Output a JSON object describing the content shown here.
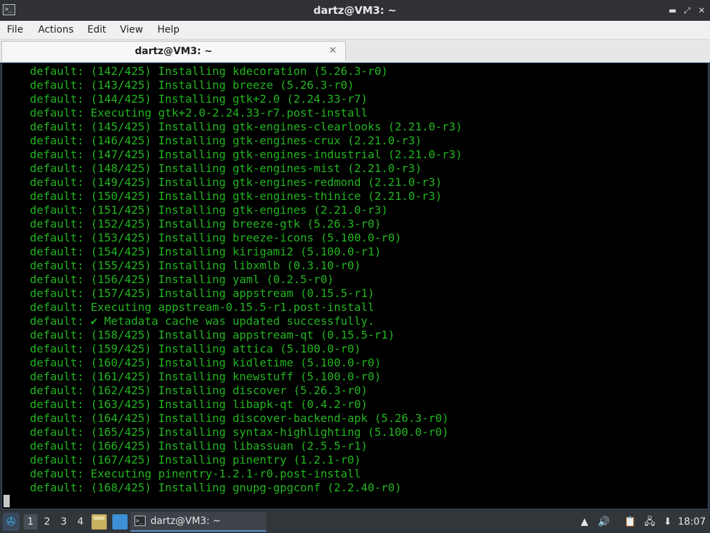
{
  "window": {
    "title": "dartz@VM3: ~",
    "app_icon": "terminal-icon",
    "buttons": {
      "minimize": "▬",
      "maximize": "⤢",
      "close": "✕"
    }
  },
  "menubar": {
    "items": [
      "File",
      "Actions",
      "Edit",
      "View",
      "Help"
    ]
  },
  "tabs": [
    {
      "label": "dartz@VM3: ~",
      "close": "✕"
    }
  ],
  "terminal": {
    "text_color": "#22b51f",
    "background": "#000000",
    "lines": [
      "default: (142/425) Installing kdecoration (5.26.3-r0)",
      "default: (143/425) Installing breeze (5.26.3-r0)",
      "default: (144/425) Installing gtk+2.0 (2.24.33-r7)",
      "default: Executing gtk+2.0-2.24.33-r7.post-install",
      "default: (145/425) Installing gtk-engines-clearlooks (2.21.0-r3)",
      "default: (146/425) Installing gtk-engines-crux (2.21.0-r3)",
      "default: (147/425) Installing gtk-engines-industrial (2.21.0-r3)",
      "default: (148/425) Installing gtk-engines-mist (2.21.0-r3)",
      "default: (149/425) Installing gtk-engines-redmond (2.21.0-r3)",
      "default: (150/425) Installing gtk-engines-thinice (2.21.0-r3)",
      "default: (151/425) Installing gtk-engines (2.21.0-r3)",
      "default: (152/425) Installing breeze-gtk (5.26.3-r0)",
      "default: (153/425) Installing breeze-icons (5.100.0-r0)",
      "default: (154/425) Installing kirigami2 (5.100.0-r1)",
      "default: (155/425) Installing libxmlb (0.3.10-r0)",
      "default: (156/425) Installing yaml (0.2.5-r0)",
      "default: (157/425) Installing appstream (0.15.5-r1)",
      "default: Executing appstream-0.15.5-r1.post-install",
      "default: ✔ Metadata cache was updated successfully.",
      "default: (158/425) Installing appstream-qt (0.15.5-r1)",
      "default: (159/425) Installing attica (5.100.0-r0)",
      "default: (160/425) Installing kidletime (5.100.0-r0)",
      "default: (161/425) Installing knewstuff (5.100.0-r0)",
      "default: (162/425) Installing discover (5.26.3-r0)",
      "default: (163/425) Installing libapk-qt (0.4.2-r0)",
      "default: (164/425) Installing discover-backend-apk (5.26.3-r0)",
      "default: (165/425) Installing syntax-highlighting (5.100.0-r0)",
      "default: (166/425) Installing libassuan (2.5.5-r1)",
      "default: (167/425) Installing pinentry (1.2.1-r0)",
      "default: Executing pinentry-1.2.1-r0.post-install",
      "default: (168/425) Installing gnupg-gpgconf (2.2.40-r0)"
    ]
  },
  "taskbar": {
    "start_icon": "lxqt-start-icon",
    "desktops": [
      "1",
      "2",
      "3",
      "4"
    ],
    "active_desktop": "1",
    "quicklaunch": [
      "file-manager-icon",
      "show-desktop-icon"
    ],
    "task": {
      "label": "dartz@VM3: ~",
      "icon": "terminal-icon"
    },
    "tray": [
      "removable-media-icon",
      "volume-icon",
      "clipboard-icon",
      "network-icon",
      "update-notifier-icon"
    ],
    "clock": "18:07"
  }
}
